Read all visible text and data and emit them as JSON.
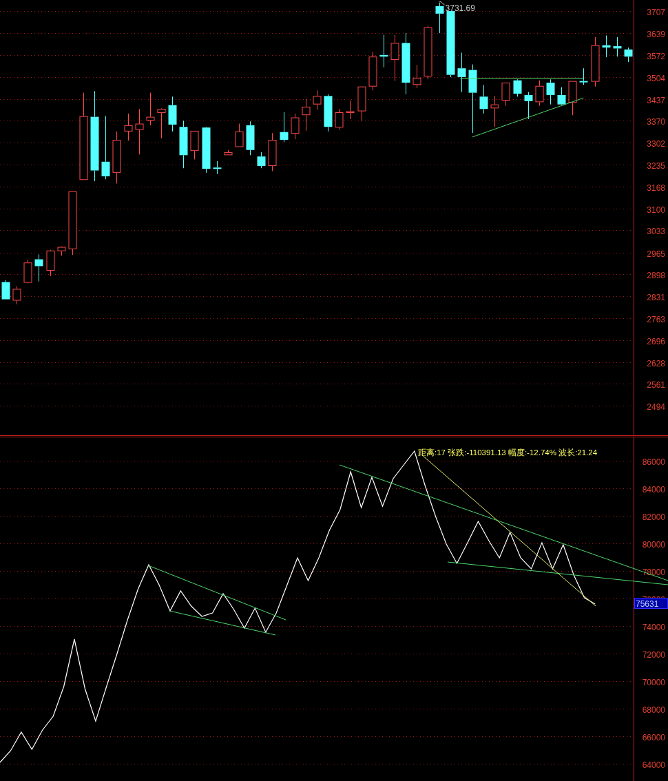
{
  "price_panel": {
    "high_marker": {
      "text": "3731.69"
    },
    "chart_data": {
      "type": "candlestick",
      "grid": true,
      "ylim": [
        2401,
        3741
      ],
      "yticks": [
        {
          "value": 3707,
          "label": "3707"
        },
        {
          "value": 3639,
          "label": "3639"
        },
        {
          "value": 3572,
          "label": "3572"
        },
        {
          "value": 3504,
          "label": "3504"
        },
        {
          "value": 3437,
          "label": "3437"
        },
        {
          "value": 3370,
          "label": "3370"
        },
        {
          "value": 3302,
          "label": "3302"
        },
        {
          "value": 3235,
          "label": "3235"
        },
        {
          "value": 3168,
          "label": "3168"
        },
        {
          "value": 3100,
          "label": "3100"
        },
        {
          "value": 3033,
          "label": "3033"
        },
        {
          "value": 2965,
          "label": "2965"
        },
        {
          "value": 2898,
          "label": "2898"
        },
        {
          "value": 2831,
          "label": "2831"
        },
        {
          "value": 2763,
          "label": "2763"
        },
        {
          "value": 2696,
          "label": "2696"
        },
        {
          "value": 2628,
          "label": "2628"
        },
        {
          "value": 2561,
          "label": "2561"
        },
        {
          "value": 2494,
          "label": "2494"
        }
      ],
      "categories": [
        null,
        null,
        null,
        null,
        null,
        null,
        null,
        null,
        null,
        null,
        null,
        null,
        null,
        null,
        null,
        null,
        null,
        null,
        null,
        null,
        null,
        null,
        null,
        null,
        null,
        null,
        null,
        null,
        null,
        null,
        null,
        null,
        null,
        null,
        null,
        null,
        null,
        null,
        null,
        null,
        null,
        null,
        null,
        null,
        null,
        null,
        null,
        null,
        null,
        null,
        null,
        null,
        null,
        null,
        null,
        null,
        null
      ],
      "ohlc": [
        [
          2874,
          2880,
          2821,
          2821
        ],
        [
          2817,
          2861,
          2806,
          2853
        ],
        [
          2872,
          2942,
          2870,
          2934
        ],
        [
          2944,
          2959,
          2876,
          2923
        ],
        [
          2909,
          2973,
          2892,
          2971
        ],
        [
          2969,
          2984,
          2955,
          2982
        ],
        [
          2975,
          3153,
          2957,
          3153
        ],
        [
          3188,
          3456,
          3188,
          3384
        ],
        [
          3382,
          3461,
          3184,
          3217
        ],
        [
          3244,
          3384,
          3190,
          3199
        ],
        [
          3210,
          3337,
          3177,
          3311
        ],
        [
          3337,
          3392,
          3309,
          3356
        ],
        [
          3342,
          3406,
          3266,
          3361
        ],
        [
          3370,
          3456,
          3356,
          3382
        ],
        [
          3394,
          3408,
          3316,
          3406
        ],
        [
          3418,
          3444,
          3337,
          3358
        ],
        [
          3351,
          3370,
          3224,
          3264
        ],
        [
          3277,
          3339,
          3251,
          3339
        ],
        [
          3349,
          3351,
          3210,
          3222
        ],
        [
          3226,
          3246,
          3206,
          3222
        ],
        [
          3264,
          3280,
          3264,
          3273
        ],
        [
          3289,
          3361,
          3289,
          3337
        ],
        [
          3356,
          3368,
          3264,
          3280
        ],
        [
          3260,
          3273,
          3224,
          3231
        ],
        [
          3231,
          3332,
          3215,
          3311
        ],
        [
          3335,
          3396,
          3304,
          3311
        ],
        [
          3330,
          3392,
          3313,
          3380
        ],
        [
          3387,
          3437,
          3339,
          3413
        ],
        [
          3420,
          3463,
          3404,
          3446
        ],
        [
          3446,
          3451,
          3337,
          3351
        ],
        [
          3349,
          3406,
          3342,
          3396
        ],
        [
          3394,
          3432,
          3375,
          3399
        ],
        [
          3399,
          3475,
          3368,
          3475
        ],
        [
          3475,
          3582,
          3463,
          3567
        ],
        [
          3572,
          3634,
          3534,
          3567
        ],
        [
          3557,
          3634,
          3492,
          3609
        ],
        [
          3609,
          3639,
          3451,
          3487
        ],
        [
          3480,
          3542,
          3470,
          3502
        ],
        [
          3506,
          3662,
          3497,
          3657
        ],
        [
          3722,
          3732,
          3639,
          3699
        ],
        [
          3707,
          3707,
          3504,
          3511
        ],
        [
          3531,
          3579,
          3458,
          3504
        ],
        [
          3526,
          3543,
          3332,
          3456
        ],
        [
          3444,
          3480,
          3392,
          3406
        ],
        [
          3408,
          3446,
          3351,
          3420
        ],
        [
          3432,
          3487,
          3416,
          3487
        ],
        [
          3494,
          3497,
          3444,
          3453
        ],
        [
          3449,
          3458,
          3375,
          3430
        ],
        [
          3427,
          3494,
          3416,
          3477
        ],
        [
          3487,
          3497,
          3420,
          3449
        ],
        [
          3449,
          3473,
          3418,
          3420
        ],
        [
          3425,
          3492,
          3387,
          3492
        ],
        [
          3492,
          3531,
          3480,
          3490
        ],
        [
          3490,
          3627,
          3475,
          3602
        ],
        [
          3602,
          3632,
          3565,
          3595
        ],
        [
          3599,
          3627,
          3567,
          3592
        ],
        [
          3589,
          3595,
          3550,
          3567
        ]
      ]
    }
  },
  "wave_panel": {
    "measure_label": "距离:17 张跌:-110391.13 幅度:-12.74% 波长:21.24",
    "last_value_tag": "75631",
    "chart_data": {
      "type": "line",
      "grid": true,
      "ylim": [
        62750,
        87750
      ],
      "yticks": [
        64000,
        66000,
        68000,
        70000,
        72000,
        74000,
        76000,
        78000,
        80000,
        82000,
        84000,
        86000
      ],
      "series": [
        {
          "color": "#ffffff",
          "values": [
            64100,
            64950,
            66300,
            65050,
            66450,
            67450,
            69600,
            73050,
            69450,
            67100,
            69550,
            71950,
            74450,
            76700,
            78450,
            76950,
            75100,
            76550,
            75450,
            74700,
            74950,
            76350,
            75200,
            73850,
            75300,
            73550,
            74950,
            76950,
            78950,
            77300,
            78950,
            80950,
            82450,
            85200,
            82600,
            84800,
            82700,
            84700,
            85700,
            86700,
            84200,
            81950,
            79950,
            78550,
            80050,
            81600,
            80200,
            78950,
            80800,
            78950,
            78150,
            80050,
            78150,
            79900,
            77700,
            76050,
            75600
          ]
        }
      ]
    }
  }
}
